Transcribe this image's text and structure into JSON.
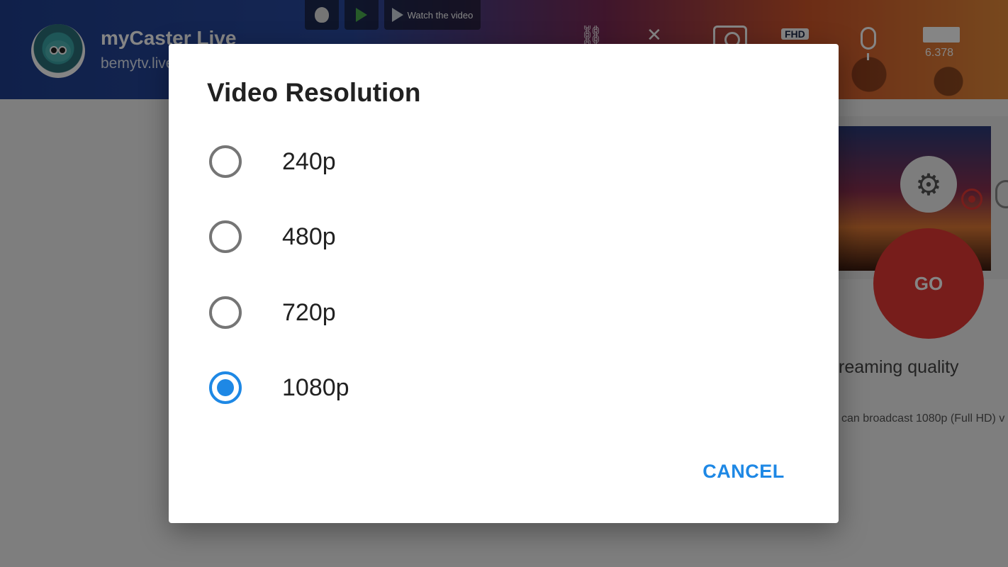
{
  "app": {
    "title": "myCaster Live",
    "subtitle": "bemytv.live",
    "watch_label": "Watch the video",
    "fhd_badge": "FHD",
    "speed_value": "6.378",
    "go_label": "GO",
    "streaming_quality_text": "reaming quality",
    "broadcast_text": "can broadcast 1080p (Full HD) v"
  },
  "dialog": {
    "title": "Video Resolution",
    "options": [
      {
        "label": "240p",
        "selected": false
      },
      {
        "label": "480p",
        "selected": false
      },
      {
        "label": "720p",
        "selected": false
      },
      {
        "label": "1080p",
        "selected": true
      }
    ],
    "cancel_label": "CANCEL"
  },
  "colors": {
    "accent": "#1e88e5",
    "go_button": "#e53935",
    "radio_unselected": "#757575"
  },
  "icons": [
    "apple-icon",
    "play-store-icon",
    "play-icon",
    "link-icon",
    "pin-icon",
    "camera-icon",
    "mic-icon",
    "speed-gauge-icon",
    "gear-icon",
    "record-icon"
  ]
}
